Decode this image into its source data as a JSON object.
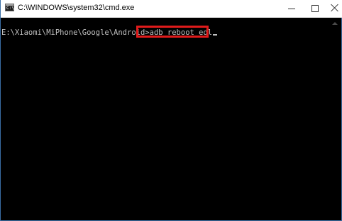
{
  "window": {
    "title": "C:\\WINDOWS\\system32\\cmd.exe",
    "icon_label": "C:\\",
    "controls": {
      "minimize": "minimize-icon",
      "maximize": "maximize-icon",
      "close": "close-icon"
    }
  },
  "console": {
    "prompt": "E:\\Xiaomi\\MiPhone\\Google\\Android>",
    "command": "adb reboot edl",
    "text_color": "#c0c0c0",
    "background_color": "#000000",
    "highlight_color": "#e01b1b"
  }
}
